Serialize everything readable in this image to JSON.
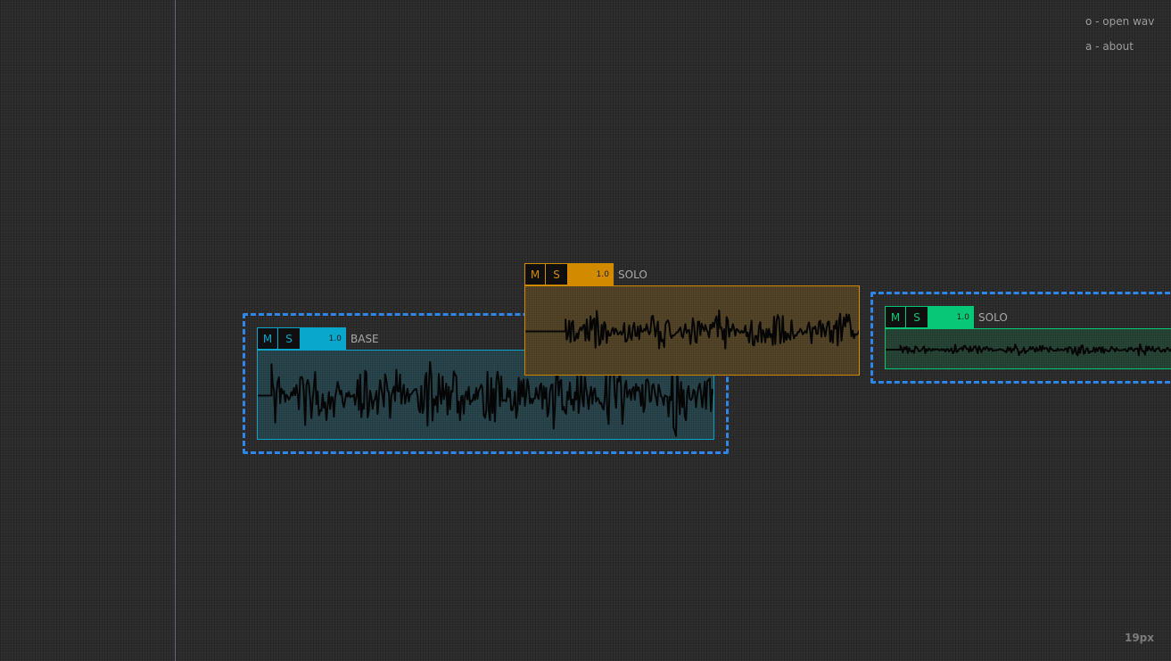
{
  "menu": {
    "open_wav": "o - open wav",
    "about": "a - about"
  },
  "zoom_label": "19px",
  "clips": [
    {
      "name": "BASE",
      "mute_label": "M",
      "solo_label": "S",
      "gain": "1.0",
      "accent": "#0aa7cc",
      "fill": "#2b4a52",
      "selected": true,
      "amplitude": 0.9,
      "waveform_start": 0.03
    },
    {
      "name": "SOLO",
      "mute_label": "M",
      "solo_label": "S",
      "gain": "1.0",
      "accent": "#d28a00",
      "fill": "#5a4a2a",
      "selected": false,
      "amplitude": 0.5,
      "waveform_start": 0.12
    },
    {
      "name": "SOLO",
      "mute_label": "M",
      "solo_label": "S",
      "gain": "1.0",
      "accent": "#08c877",
      "fill": "#2a4a3a",
      "selected": true,
      "amplitude": 0.3,
      "waveform_start": 0.05
    }
  ]
}
